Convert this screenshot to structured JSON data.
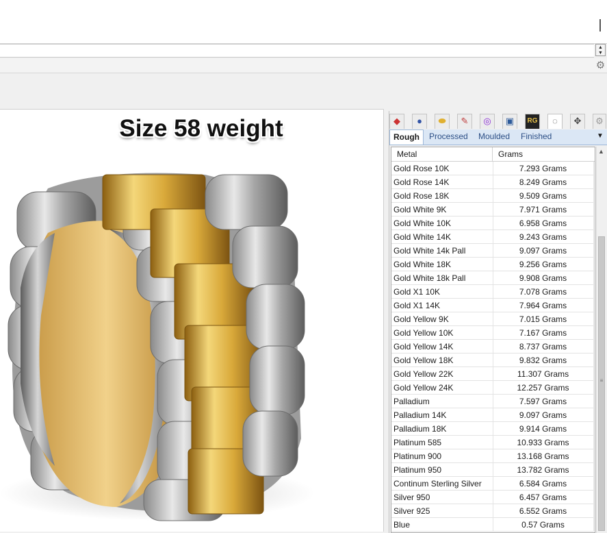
{
  "command_area": {
    "history_text": "",
    "input_value": ""
  },
  "viewport": {
    "title": "Size 58 weight"
  },
  "panel": {
    "icons": [
      "material-icon",
      "sphere-icon",
      "gem-icon",
      "paint-icon",
      "color-wheel-icon",
      "render-icon",
      "rg-icon",
      "ring-size-icon",
      "move-icon",
      "settings-icon"
    ],
    "rg_label": "RG",
    "tabs": [
      "Rough",
      "Processed",
      "Moulded",
      "Finished"
    ],
    "active_tab": "Rough",
    "table": {
      "headers": [
        "Metal",
        "Grams"
      ],
      "rows": [
        {
          "metal": "Gold Rose 10K",
          "grams": "7.293 Grams"
        },
        {
          "metal": "Gold Rose 14K",
          "grams": "8.249 Grams"
        },
        {
          "metal": "Gold Rose 18K",
          "grams": "9.509 Grams"
        },
        {
          "metal": "Gold White 9K",
          "grams": "7.971 Grams"
        },
        {
          "metal": "Gold White 10K",
          "grams": "6.958 Grams"
        },
        {
          "metal": "Gold White 14K",
          "grams": "9.243 Grams"
        },
        {
          "metal": "Gold White 14k Pall",
          "grams": "9.097 Grams"
        },
        {
          "metal": "Gold White 18K",
          "grams": "9.256 Grams"
        },
        {
          "metal": "Gold White 18k Pall",
          "grams": "9.908 Grams"
        },
        {
          "metal": "Gold X1 10K",
          "grams": "7.078 Grams"
        },
        {
          "metal": "Gold X1 14K",
          "grams": "7.964 Grams"
        },
        {
          "metal": "Gold Yellow 9K",
          "grams": "7.015 Grams"
        },
        {
          "metal": "Gold Yellow 10K",
          "grams": "7.167 Grams"
        },
        {
          "metal": "Gold Yellow 14K",
          "grams": "8.737 Grams"
        },
        {
          "metal": "Gold Yellow 18K",
          "grams": "9.832 Grams"
        },
        {
          "metal": "Gold Yellow 22K",
          "grams": "11.307 Grams"
        },
        {
          "metal": "Gold Yellow 24K",
          "grams": "12.257 Grams"
        },
        {
          "metal": "Palladium",
          "grams": "7.597 Grams"
        },
        {
          "metal": "Palladium 14K",
          "grams": "9.097 Grams"
        },
        {
          "metal": "Palladium 18K",
          "grams": "9.914 Grams"
        },
        {
          "metal": "Platinum 585",
          "grams": "10.933 Grams"
        },
        {
          "metal": "Platinum 900",
          "grams": "13.168 Grams"
        },
        {
          "metal": "Platinum 950",
          "grams": "13.782 Grams"
        },
        {
          "metal": "Continum Sterling Silver",
          "grams": "6.584 Grams"
        },
        {
          "metal": "Silver 950",
          "grams": "6.457 Grams"
        },
        {
          "metal": "Silver 925",
          "grams": "6.552 Grams"
        },
        {
          "metal": "Blue",
          "grams": "0.57 Grams"
        }
      ]
    }
  },
  "colors": {
    "gold": "#d9a93a",
    "silver": "#b7b7b7",
    "tab_blue": "#dbe7f5"
  }
}
